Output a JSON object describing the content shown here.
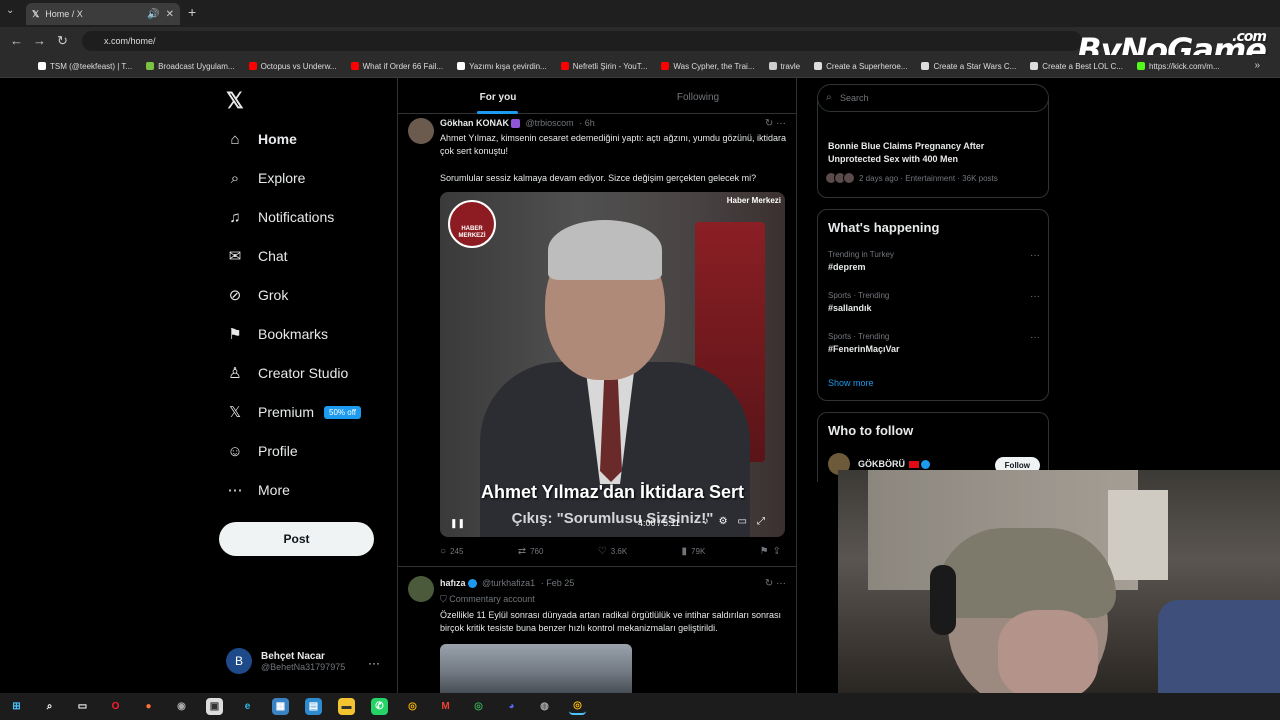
{
  "browser": {
    "tab_title": "Home / X",
    "url": "x.com/home/",
    "brand": "ByNoGame",
    "brand_suffix": ".com",
    "bookmarks": [
      {
        "label": "TSM (@teekfeast) | T...",
        "color": "#ffffff"
      },
      {
        "label": "Broadcast Uygulam...",
        "color": "#7cc242"
      },
      {
        "label": "Octopus vs Underw...",
        "color": "#ff0000"
      },
      {
        "label": "What if Order 66 Fail...",
        "color": "#ff0000"
      },
      {
        "label": "Yazımı kışa çevirdin...",
        "color": "#ffffff"
      },
      {
        "label": "Nefretli Şirin - YouT...",
        "color": "#ff0000"
      },
      {
        "label": "Was Cypher, the Trai...",
        "color": "#ff0000"
      },
      {
        "label": "travle",
        "color": "#cccccc"
      },
      {
        "label": "Create a Superheroe...",
        "color": "#dddddd"
      },
      {
        "label": "Create a Star Wars C...",
        "color": "#dddddd"
      },
      {
        "label": "Create a Best LOL C...",
        "color": "#dddddd"
      },
      {
        "label": "https://kick.com/m...",
        "color": "#53fc18"
      }
    ]
  },
  "sidebar": {
    "logo": "𝕏",
    "items": [
      {
        "label": "Home",
        "icon": "⌂"
      },
      {
        "label": "Explore",
        "icon": "⌕"
      },
      {
        "label": "Notifications",
        "icon": "♫"
      },
      {
        "label": "Chat",
        "icon": "✉"
      },
      {
        "label": "Grok",
        "icon": "⊘"
      },
      {
        "label": "Bookmarks",
        "icon": "⚑"
      },
      {
        "label": "Creator Studio",
        "icon": "♙"
      },
      {
        "label": "Premium",
        "icon": "𝕏"
      },
      {
        "label": "Profile",
        "icon": "☺"
      },
      {
        "label": "More",
        "icon": "⋯"
      }
    ],
    "premium_badge": "50% off",
    "post_label": "Post",
    "account": {
      "initial": "B",
      "name": "Behçet Nacar",
      "handle": "@BehetNa31797975"
    }
  },
  "feed": {
    "tabs": [
      "For you",
      "Following"
    ],
    "tweet1": {
      "name": "Gökhan KONAK",
      "handle": "@trbioscom",
      "time": "· 6h",
      "text1": "Ahmet Yılmaz, kimsenin cesaret edemediğini yaptı: açtı ağzını, yumdu gözünü, iktidara çok sert konuştu!",
      "text2": "Sorumlular sessiz kalmaya devam ediyor. Sizce değişim gerçekten gelecek mi?",
      "video_logo": "HABER MERKEZİ",
      "video_corner": "Haber Merkezi",
      "caption1": "Ahmet Yılmaz'dan İktidara Sert",
      "caption2": "Çıkış: \"Sorumlusu Sizsiniz!\"",
      "video_time": "4:00 / 5:11",
      "replies": "245",
      "reposts": "760",
      "likes": "3.6K",
      "views": "79K"
    },
    "tweet2": {
      "name": "hafıza",
      "handle": "@turkhafiza1",
      "time": "· Feb 25",
      "tag": "Commentary account",
      "text": "Özellikle 11 Eylül sonrası dünyada artan radikal örgütlülük ve intihar saldırıları sonrası birçok kritik tesiste buna benzer hızlı kontrol mekanizmaları geliştirildi."
    }
  },
  "right": {
    "search_placeholder": "Search",
    "news": {
      "title": "Bonnie Blue Claims Pregnancy After Unprotected Sex with 400 Men",
      "meta": "2 days ago · Entertainment · 36K posts"
    },
    "happening_title": "What's happening",
    "trends": [
      {
        "meta": "Trending in Turkey",
        "name": "#deprem"
      },
      {
        "meta": "Sports · Trending",
        "name": "#sallandık"
      },
      {
        "meta": "Sports · Trending",
        "name": "#FenerinMaçıVar"
      }
    ],
    "show_more": "Show more",
    "wtf_title": "Who to follow",
    "wtf_name": "GÖKBÖRÜ",
    "follow_label": "Follow"
  }
}
